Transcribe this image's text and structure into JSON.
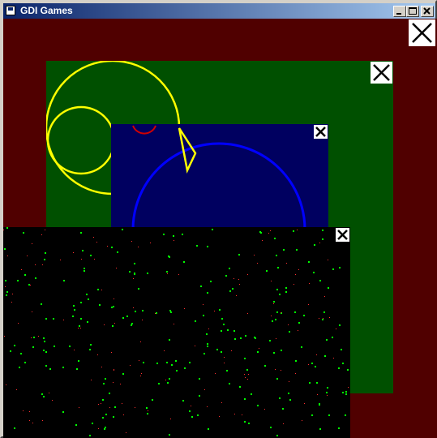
{
  "window": {
    "title": "GDI Games",
    "title_icon": "app-window-icon",
    "buttons": [
      "minimize",
      "maximize",
      "close"
    ]
  },
  "colors": {
    "outer_panel": "#500000",
    "green_panel": "#005000",
    "blue_panel": "#000060",
    "black_panel": "#000000",
    "yellow": "#ffff00",
    "red": "#d00000",
    "blue": "#0000ff",
    "star_green": "#00ff00",
    "star_red": "#ff3030"
  },
  "panels": [
    {
      "name": "outer",
      "close_icon": "close-x-icon"
    },
    {
      "name": "green",
      "close_icon": "close-x-icon"
    },
    {
      "name": "blue",
      "close_icon": "close-x-icon"
    },
    {
      "name": "starfield",
      "close_icon": "close-x-icon"
    }
  ]
}
